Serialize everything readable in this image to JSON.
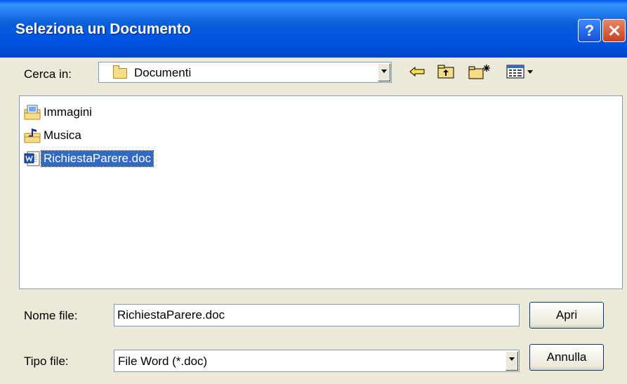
{
  "dialog": {
    "title": "Seleziona un Documento",
    "help_label": "?"
  },
  "lookin": {
    "label": "Cerca in:",
    "value": "Documenti"
  },
  "toolbar": {
    "icons": [
      "back-icon",
      "up-folder-icon",
      "new-folder-icon",
      "view-menu-icon"
    ]
  },
  "files": [
    {
      "name": "Immagini",
      "icon": "pictures-folder-icon",
      "selected": false
    },
    {
      "name": "Musica",
      "icon": "music-folder-icon",
      "selected": false
    },
    {
      "name": "RichiestaParere.doc",
      "icon": "word-document-icon",
      "selected": true
    }
  ],
  "filename": {
    "label": "Nome file:",
    "value": "RichiestaParere.doc"
  },
  "filetype": {
    "label": "Tipo file:",
    "value": "File Word (*.doc)"
  },
  "buttons": {
    "open": "Apri",
    "cancel": "Annulla"
  },
  "colors": {
    "titlebar": "#0054e3",
    "selection": "#316ac5",
    "dialog_bg": "#ece9d8"
  }
}
